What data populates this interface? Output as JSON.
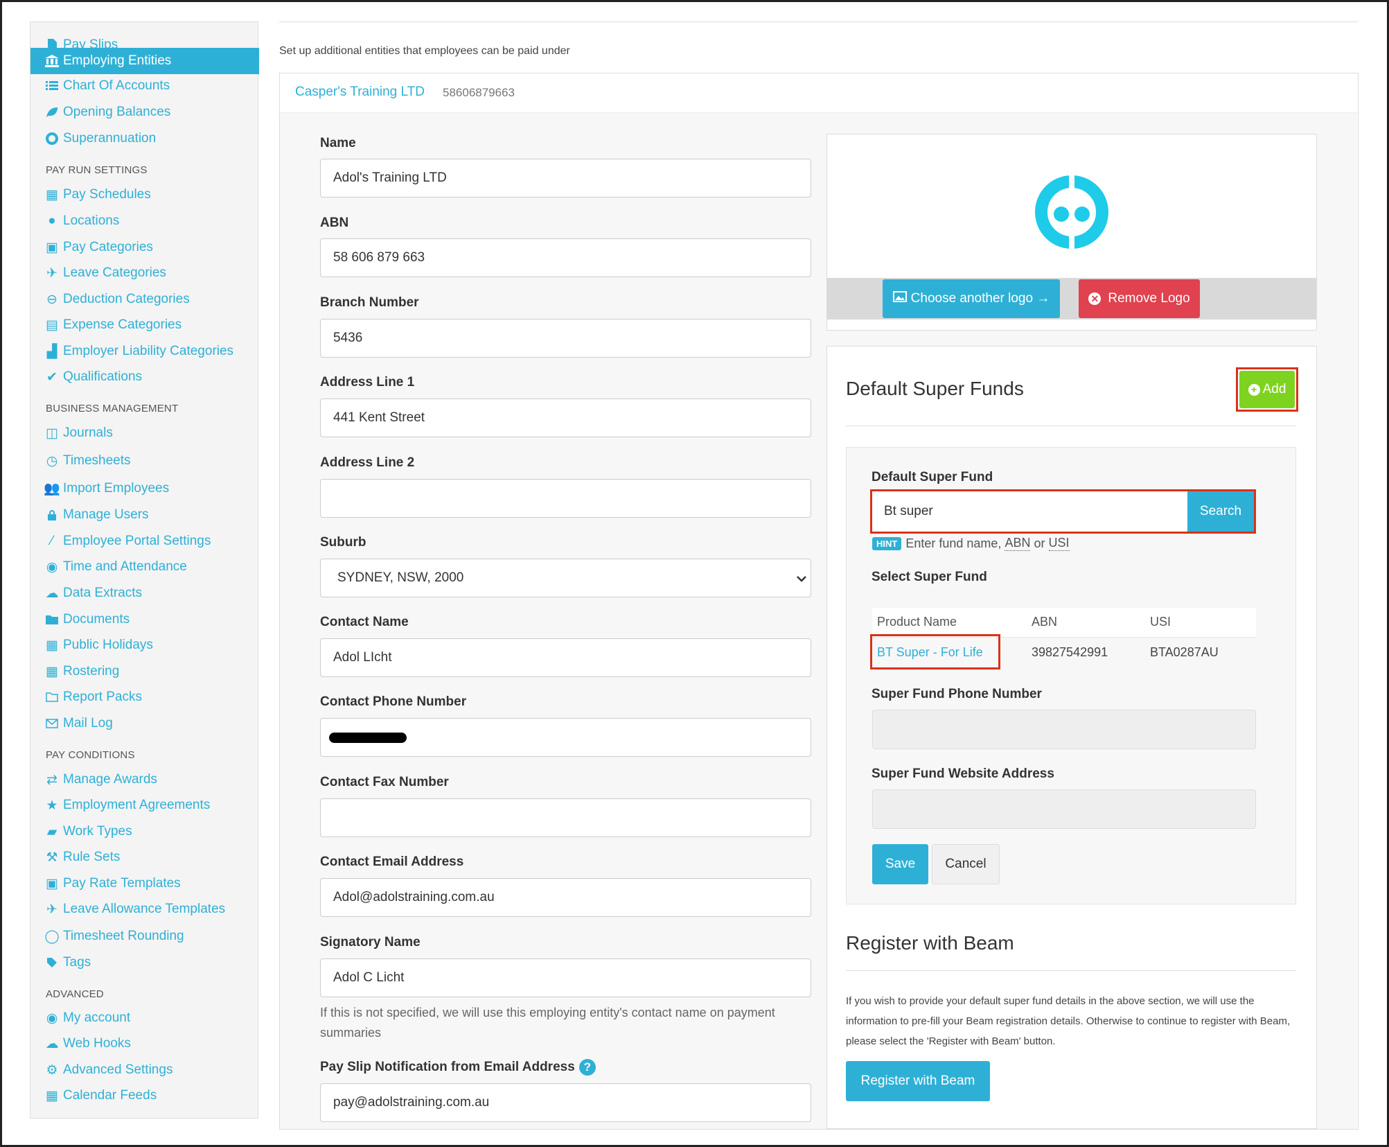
{
  "sidebar": {
    "items": [
      {
        "label": "Pay Slips",
        "icon": "file-icon",
        "active": false
      },
      {
        "label": "Employing Entities",
        "icon": "bank-icon",
        "active": true
      },
      {
        "label": "Chart Of Accounts",
        "icon": "list-icon",
        "active": false
      },
      {
        "label": "Opening Balances",
        "icon": "leaf-icon",
        "active": false
      },
      {
        "label": "Superannuation",
        "icon": "life-ring-icon",
        "active": false
      }
    ],
    "pay_run_heading": "PAY RUN SETTINGS",
    "pay_run_items": [
      {
        "label": "Pay Schedules",
        "icon": "calendar-icon"
      },
      {
        "label": "Locations",
        "icon": "globe-icon"
      },
      {
        "label": "Pay Categories",
        "icon": "money-icon"
      },
      {
        "label": "Leave Categories",
        "icon": "plane-icon"
      },
      {
        "label": "Deduction Categories",
        "icon": "minus-circle-icon"
      },
      {
        "label": "Expense Categories",
        "icon": "archive-icon"
      },
      {
        "label": "Employer Liability Categories",
        "icon": "industry-icon"
      },
      {
        "label": "Qualifications",
        "icon": "check-icon"
      }
    ],
    "business_heading": "BUSINESS MANAGEMENT",
    "business_items": [
      {
        "label": "Journals",
        "icon": "columns-icon"
      },
      {
        "label": "Timesheets",
        "icon": "clock-icon"
      },
      {
        "label": "Import Employees",
        "icon": "people-icon"
      },
      {
        "label": "Manage Users",
        "icon": "lock-icon"
      },
      {
        "label": "Employee Portal Settings",
        "icon": "magic-icon"
      },
      {
        "label": "Time and Attendance",
        "icon": "user-circle-icon"
      },
      {
        "label": "Data Extracts",
        "icon": "cloud-download-icon"
      },
      {
        "label": "Documents",
        "icon": "folder-icon"
      },
      {
        "label": "Public Holidays",
        "icon": "calendar-icon"
      },
      {
        "label": "Rostering",
        "icon": "calendar-icon"
      },
      {
        "label": "Report Packs",
        "icon": "folder-open-icon"
      },
      {
        "label": "Mail Log",
        "icon": "envelope-icon"
      }
    ],
    "pay_conditions_heading": "PAY CONDITIONS",
    "pay_conditions_items": [
      {
        "label": "Manage Awards",
        "icon": "exchange-icon"
      },
      {
        "label": "Employment Agreements",
        "icon": "star-icon"
      },
      {
        "label": "Work Types",
        "icon": "book-icon"
      },
      {
        "label": "Rule Sets",
        "icon": "gavel-icon"
      },
      {
        "label": "Pay Rate Templates",
        "icon": "money-icon"
      },
      {
        "label": "Leave Allowance Templates",
        "icon": "plane-icon"
      },
      {
        "label": "Timesheet Rounding",
        "icon": "clock-outline-icon"
      },
      {
        "label": "Tags",
        "icon": "tag-icon"
      }
    ],
    "advanced_heading": "ADVANCED",
    "advanced_items": [
      {
        "label": "My account",
        "icon": "user-circle-icon"
      },
      {
        "label": "Web Hooks",
        "icon": "cloud-icon"
      },
      {
        "label": "Advanced Settings",
        "icon": "gear-icon"
      },
      {
        "label": "Calendar Feeds",
        "icon": "calendar-icon"
      }
    ]
  },
  "page": {
    "intro": "Set up additional entities that employees can be paid under",
    "entity_name": "Casper's Training LTD",
    "entity_abn": "58606879663"
  },
  "form": {
    "name_label": "Name",
    "name_value": "Adol's Training LTD",
    "abn_label": "ABN",
    "abn_value": "58 606 879 663",
    "branch_label": "Branch Number",
    "branch_value": "5436",
    "address1_label": "Address Line 1",
    "address1_value": "441 Kent Street",
    "address2_label": "Address Line 2",
    "address2_value": "",
    "suburb_label": "Suburb",
    "suburb_value": "SYDNEY, NSW, 2000",
    "contact_name_label": "Contact Name",
    "contact_name_value": "Adol LIcht",
    "contact_phone_label": "Contact Phone Number",
    "contact_fax_label": "Contact Fax Number",
    "contact_fax_value": "",
    "contact_email_label": "Contact Email Address",
    "contact_email_value": "Adol@adolstraining.com.au",
    "signatory_label": "Signatory Name",
    "signatory_value": "Adol C Licht",
    "signatory_help": "If this is not specified, we will use this employing entity's contact name on payment summaries",
    "payslip_email_label": "Pay Slip Notification from Email Address",
    "payslip_email_value": "pay@adolstraining.com.au"
  },
  "logo": {
    "choose_label": "Choose another logo →",
    "remove_label": "Remove Logo"
  },
  "super": {
    "title": "Default Super Funds",
    "add_label": "Add",
    "default_fund_label": "Default Super Fund",
    "search_value": "Bt super",
    "search_button": "Search",
    "hint_badge": "HINT",
    "hint_prefix": "Enter fund name,",
    "hint_abn": "ABN",
    "hint_or": "or",
    "hint_usi": "USI",
    "select_label": "Select Super Fund",
    "table_headers": [
      "Product Name",
      "ABN",
      "USI"
    ],
    "rows": [
      {
        "product": "BT Super - For Life",
        "abn": "39827542991",
        "usi": "BTA0287AU"
      }
    ],
    "phone_label": "Super Fund Phone Number",
    "phone_value": "",
    "website_label": "Super Fund Website Address",
    "website_value": "",
    "save_label": "Save",
    "cancel_label": "Cancel"
  },
  "beam": {
    "title": "Register with Beam",
    "description": "If you wish to provide your default super fund details in the above section, we will use the information to pre-fill your Beam registration details. Otherwise to continue to register with Beam, please select the 'Register with Beam' button.",
    "button_label": "Register with Beam"
  },
  "colors": {
    "accent": "#2eb0d6",
    "danger": "#e0424f",
    "success": "#7ed321",
    "highlight": "#d9321a"
  }
}
